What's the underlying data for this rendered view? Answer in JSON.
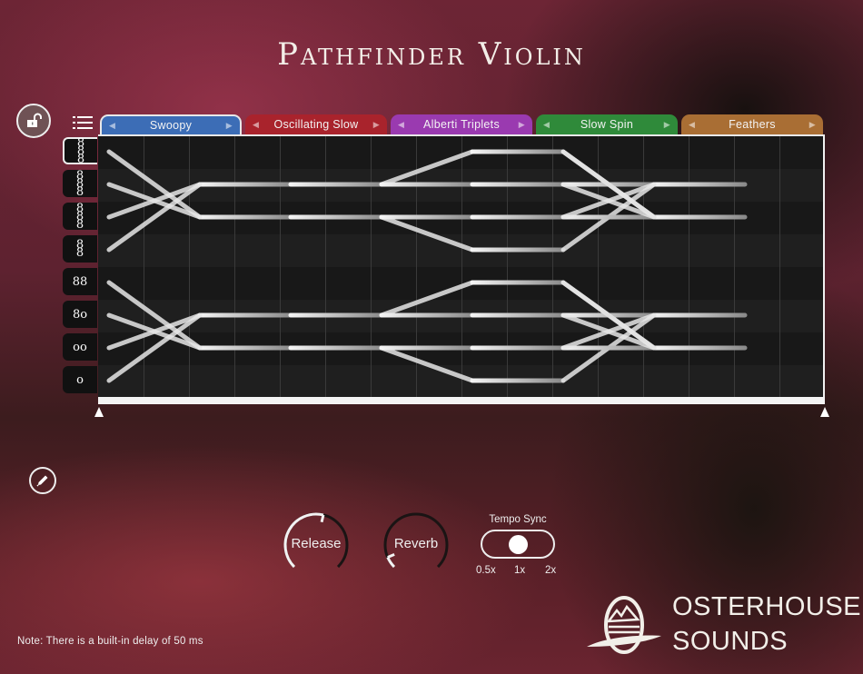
{
  "app": {
    "title": "Pathfinder Violin",
    "brand_line1": "OSTERHOUSE",
    "brand_line2": "SOUNDS",
    "note": "Note: There is a built-in delay of 50 ms"
  },
  "toolbar": {
    "lock_icon": "unlock-icon",
    "menu_icon": "list-icon",
    "edit_icon": "pencil-icon"
  },
  "tabs": [
    {
      "label": "Swoopy",
      "color": "#3c6db6",
      "active": true
    },
    {
      "label": "Oscillating Slow",
      "color": "#a9232c",
      "active": false
    },
    {
      "label": "Alberti Triplets",
      "color": "#9a3ab0",
      "active": false
    },
    {
      "label": "Slow Spin",
      "color": "#2f8a3a",
      "active": false
    },
    {
      "label": "Feathers",
      "color": "#a96e34",
      "active": false
    }
  ],
  "voice_buttons": [
    {
      "glyph": "8\n8\n8",
      "voices": 8,
      "active": true
    },
    {
      "glyph": "8\n8\n8",
      "voices": 7,
      "active": false
    },
    {
      "glyph": "8\n8\n8",
      "voices": 6,
      "active": false
    },
    {
      "glyph": "8\n8",
      "voices": 5,
      "active": false
    },
    {
      "glyph": "88",
      "voices": 4,
      "active": false
    },
    {
      "glyph": "8o",
      "voices": 3,
      "active": false
    },
    {
      "glyph": "oo",
      "voices": 2,
      "active": false
    },
    {
      "glyph": "o",
      "voices": 1,
      "active": false
    }
  ],
  "pattern": {
    "rows": 8,
    "steps": 16,
    "lines": [
      [
        [
          0,
          0
        ],
        [
          2,
          2
        ],
        [
          4,
          2
        ],
        [
          6,
          2
        ],
        [
          8,
          2
        ]
      ],
      [
        [
          0,
          1
        ],
        [
          2,
          2
        ]
      ],
      [
        [
          0,
          2
        ],
        [
          2,
          1
        ],
        [
          4,
          1
        ],
        [
          6,
          1
        ],
        [
          8,
          0
        ],
        [
          10,
          0
        ],
        [
          12,
          2
        ],
        [
          14,
          2
        ]
      ],
      [
        [
          0,
          3
        ],
        [
          2,
          1
        ]
      ],
      [
        [
          6,
          1
        ],
        [
          8,
          1
        ],
        [
          10,
          1
        ],
        [
          12,
          1
        ],
        [
          14,
          1
        ]
      ],
      [
        [
          6,
          2
        ],
        [
          8,
          3
        ],
        [
          10,
          3
        ],
        [
          12,
          1
        ]
      ],
      [
        [
          6,
          2
        ],
        [
          8,
          2
        ],
        [
          10,
          2
        ],
        [
          12,
          2
        ]
      ],
      [
        [
          10,
          0
        ],
        [
          12,
          2
        ]
      ],
      [
        [
          10,
          2
        ],
        [
          12,
          1
        ]
      ],
      [
        [
          10,
          1
        ],
        [
          12,
          2
        ]
      ],
      [
        [
          0,
          4
        ],
        [
          2,
          6
        ],
        [
          4,
          6
        ],
        [
          6,
          6
        ],
        [
          8,
          6
        ]
      ],
      [
        [
          0,
          5
        ],
        [
          2,
          6
        ]
      ],
      [
        [
          0,
          6
        ],
        [
          2,
          5
        ],
        [
          4,
          5
        ],
        [
          6,
          5
        ],
        [
          8,
          4
        ],
        [
          10,
          4
        ],
        [
          12,
          6
        ],
        [
          14,
          6
        ]
      ],
      [
        [
          0,
          7
        ],
        [
          2,
          5
        ]
      ],
      [
        [
          6,
          5
        ],
        [
          8,
          5
        ],
        [
          10,
          5
        ],
        [
          12,
          5
        ],
        [
          14,
          5
        ]
      ],
      [
        [
          6,
          6
        ],
        [
          8,
          7
        ],
        [
          10,
          7
        ],
        [
          12,
          5
        ]
      ],
      [
        [
          6,
          6
        ],
        [
          8,
          6
        ],
        [
          10,
          6
        ],
        [
          12,
          6
        ]
      ],
      [
        [
          10,
          4
        ],
        [
          12,
          6
        ]
      ],
      [
        [
          10,
          6
        ],
        [
          12,
          5
        ]
      ],
      [
        [
          10,
          5
        ],
        [
          12,
          6
        ]
      ]
    ]
  },
  "controls": {
    "release": {
      "label": "Release",
      "value": 0.55
    },
    "reverb": {
      "label": "Reverb",
      "value": 0.08
    },
    "tempo_sync": {
      "label": "Tempo Sync",
      "options": [
        "0.5x",
        "1x",
        "2x"
      ],
      "selected": "1x"
    }
  }
}
